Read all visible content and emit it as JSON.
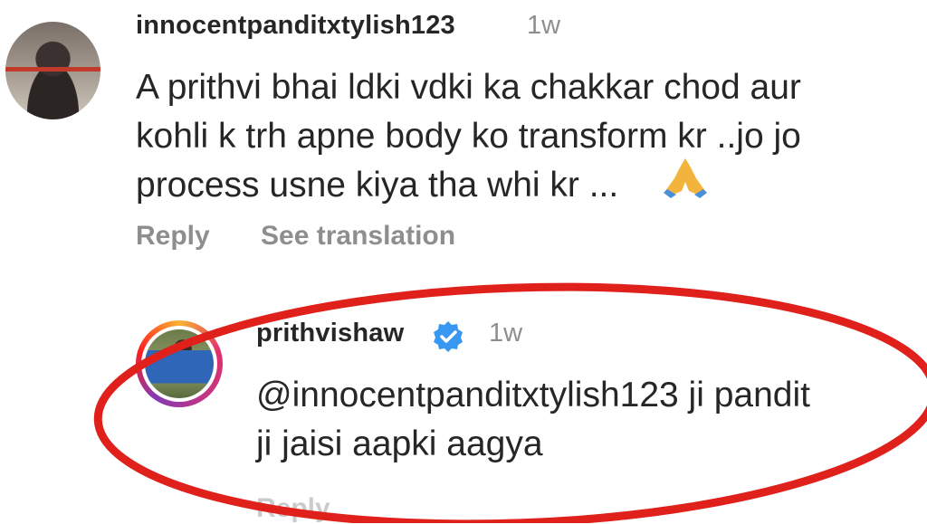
{
  "comment_1": {
    "username": "innocentpanditxtylish123",
    "time": "1w",
    "text_lines": [
      "A prithvi bhai ldki vdki ka chakkar chod aur",
      "kohli k trh apne body ko transform kr ..jo jo",
      "process usne kiya tha whi kr ..."
    ],
    "reply_label": "Reply",
    "translate_label": "See translation",
    "emoji": "🙏"
  },
  "comment_2": {
    "username": "prithvishaw",
    "verified": true,
    "time": "1w",
    "text_lines": [
      "@innocentpanditxtylish123 ji pandit",
      "ji jaisi aapki aagya"
    ],
    "reply_label": "Reply"
  },
  "colors": {
    "username": "#262626",
    "meta": "#8e8e8e",
    "verified": "#3897f0",
    "highlight_circle": "#e0201b"
  }
}
